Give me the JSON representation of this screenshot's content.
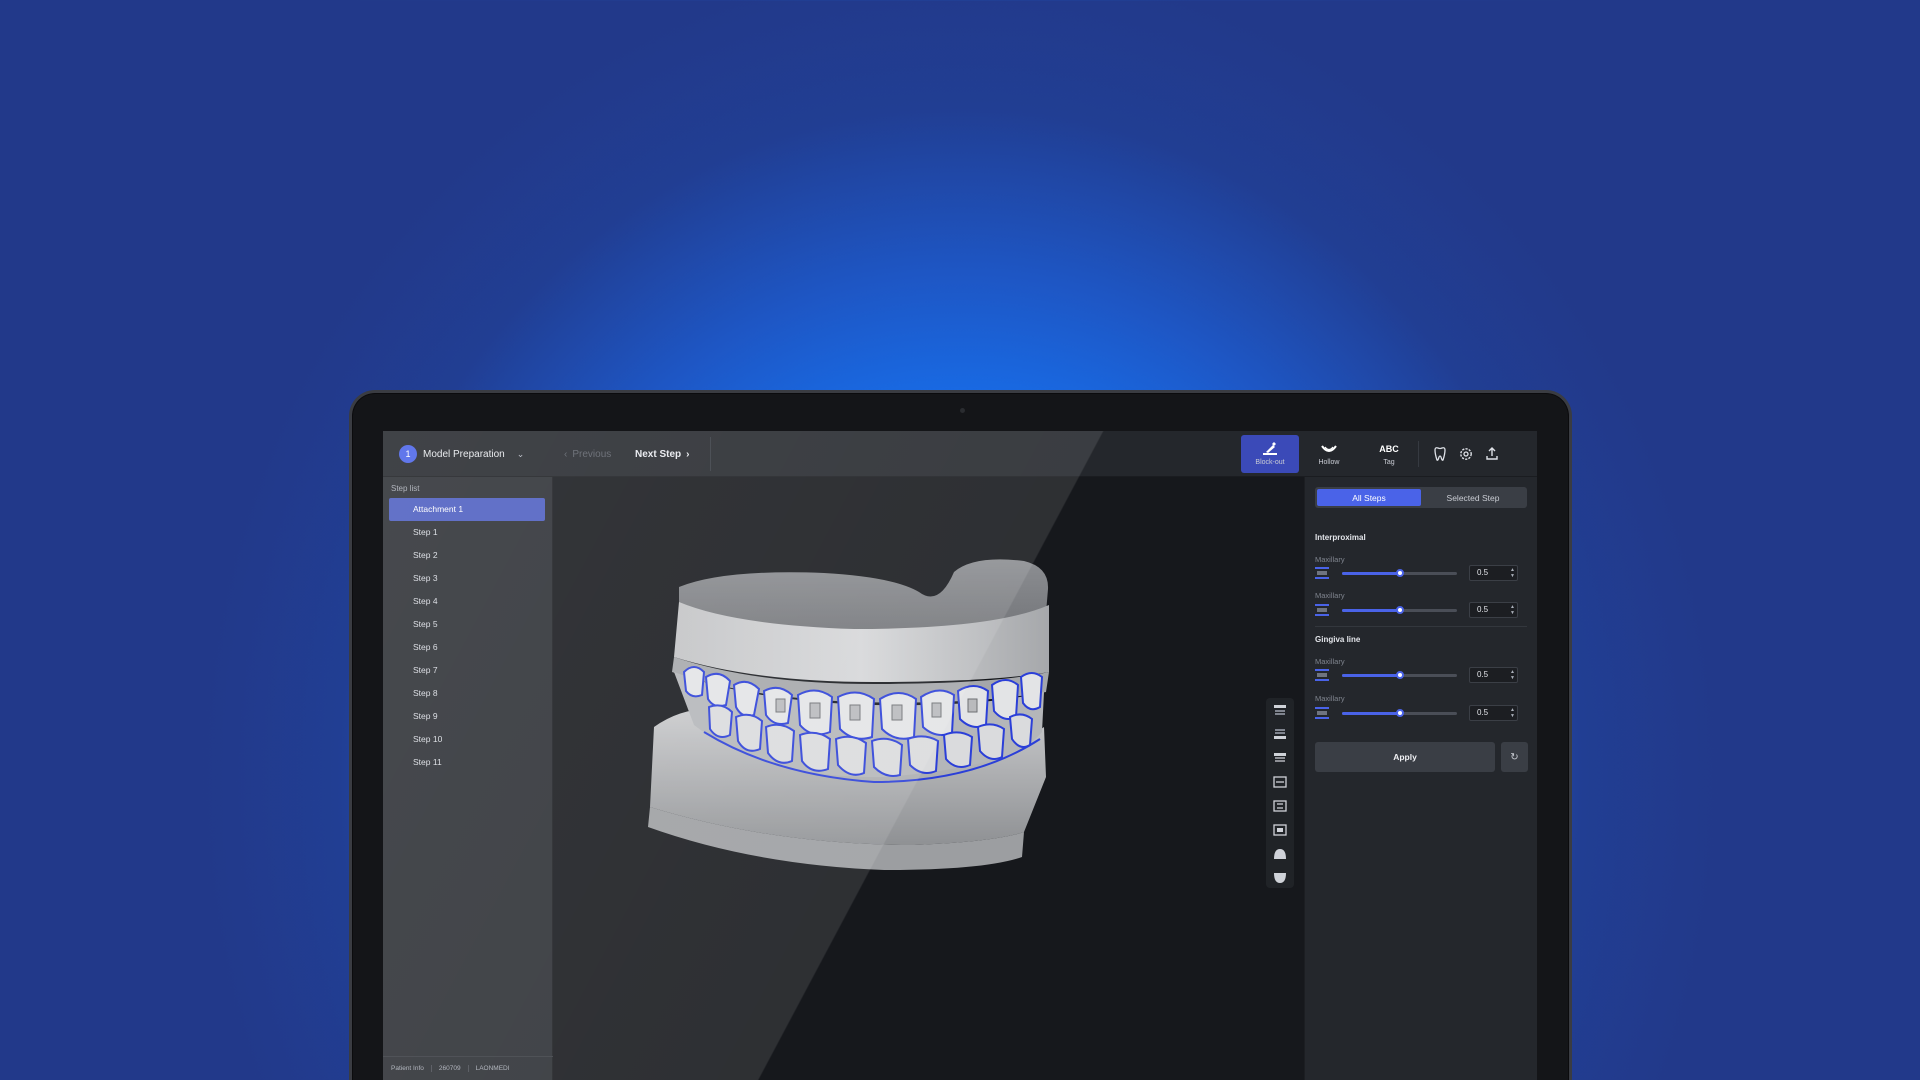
{
  "topbar": {
    "step_number": "1",
    "step_title": "Model Preparation",
    "prev_label": "Previous",
    "next_label": "Next Step",
    "tools": [
      {
        "label": "Block-out",
        "icon": "block-out-icon",
        "active": true
      },
      {
        "label": "Hollow",
        "icon": "hollow-icon",
        "active": false
      },
      {
        "label": "Tag",
        "icon_text": "ABC",
        "active": false
      }
    ],
    "icons": [
      "tooth-icon",
      "gear-icon",
      "upload-icon"
    ]
  },
  "sidebar": {
    "heading": "Step list",
    "items": [
      "Attachment 1",
      "Step 1",
      "Step 2",
      "Step 3",
      "Step 4",
      "Step 5",
      "Step 6",
      "Step 7",
      "Step 8",
      "Step 9",
      "Step 10",
      "Step 11"
    ],
    "active_index": 0,
    "footer": {
      "label": "Patient Info",
      "id": "260709",
      "name": "LAONMEDI"
    }
  },
  "panel": {
    "tabs": [
      "All Steps",
      "Selected Step"
    ],
    "active_tab": 0,
    "sections": [
      {
        "title": "Interproximal",
        "rows": [
          {
            "label": "Maxillary",
            "value": "0.5",
            "level": 0.5
          },
          {
            "label": "Maxillary",
            "value": "0.5",
            "level": 0.5
          }
        ]
      },
      {
        "title": "Gingiva line",
        "rows": [
          {
            "label": "Maxillary",
            "value": "0.5",
            "level": 0.5
          },
          {
            "label": "Maxillary",
            "value": "0.5",
            "level": 0.5
          }
        ]
      }
    ],
    "apply_label": "Apply"
  },
  "colors": {
    "accent": "#4a63e8",
    "background": "#1e56c4",
    "outline": "#2b3fd8"
  }
}
